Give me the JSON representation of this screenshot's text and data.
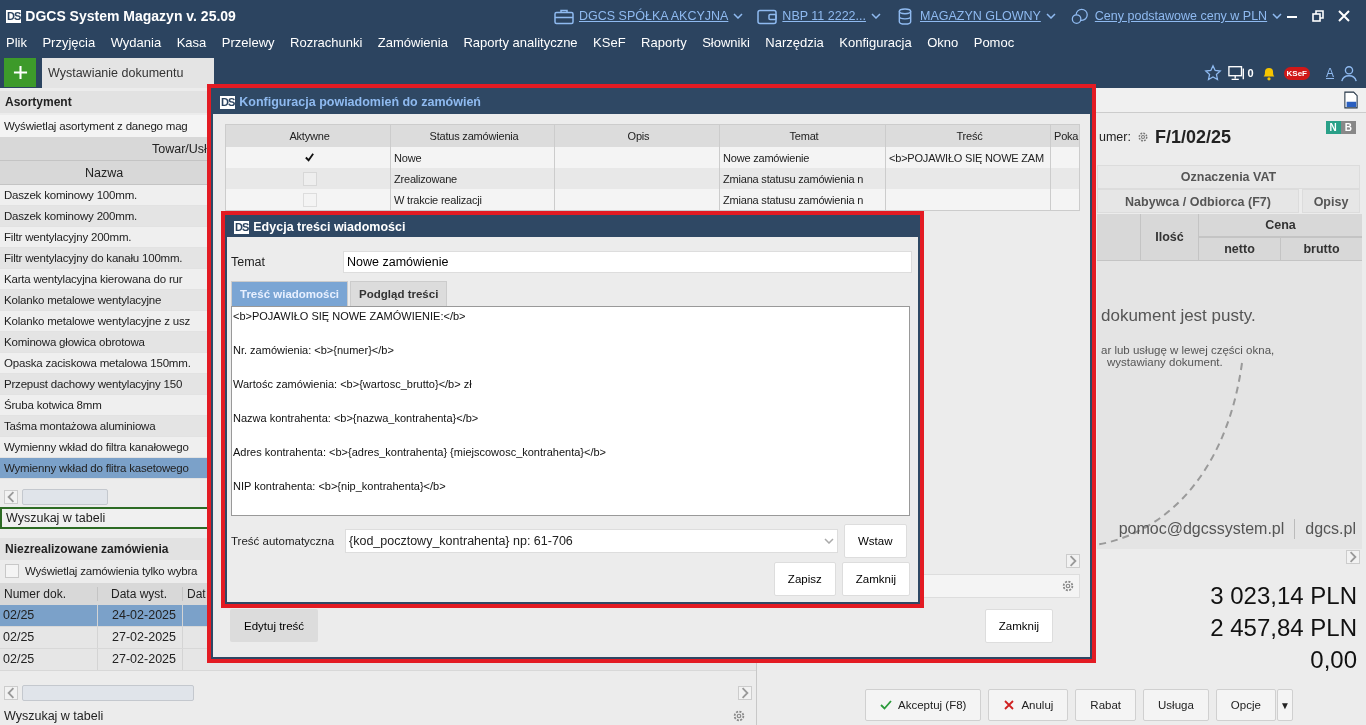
{
  "app": {
    "logo": "DS",
    "title": "DGCS System Magazyn v. 25.09"
  },
  "context": [
    {
      "kind": "company",
      "label": "DGCS SPÓŁKA AKCYJNA"
    },
    {
      "kind": "account",
      "label": "NBP 11 2222..."
    },
    {
      "kind": "warehouse",
      "label": "MAGAZYN GLOWNY"
    },
    {
      "kind": "prices",
      "label": "Ceny podstawowe ceny w PLN"
    }
  ],
  "menu": [
    "Plik",
    "Przyjęcia",
    "Wydania",
    "Kasa",
    "Przelewy",
    "Rozrachunki",
    "Zamówienia",
    "Raporty analityczne",
    "KSeF",
    "Raporty",
    "Słowniki",
    "Narzędzia",
    "Konfiguracja",
    "Okno",
    "Pomoc"
  ],
  "tabs": [
    {
      "label": "Wystawianie dokumentu",
      "selected": true
    }
  ],
  "toolbar": {
    "notifications": "0",
    "ksef": "KSeF",
    "font": "A"
  },
  "assortment": {
    "title": "Asortyment",
    "filter": "Wyświetlaj asortyment z danego mag",
    "group_header": "Towar/Usł",
    "column": "Nazwa",
    "search_placeholder": "Wyszukaj w tabeli",
    "rows": [
      {
        "name": "Daszek kominowy 100mm.",
        "selected": false
      },
      {
        "name": "Daszek kominowy 200mm.",
        "selected": false
      },
      {
        "name": "Filtr wentylacyjny 200mm.",
        "selected": false
      },
      {
        "name": "Filtr wentylacyjny do kanału 100mm.",
        "selected": false
      },
      {
        "name": "Karta wentylacyjna kierowana do rur",
        "selected": false
      },
      {
        "name": "Kolanko metalowe wentylacyjne",
        "selected": false
      },
      {
        "name": "Kolanko metalowe wentylacyjne z usz",
        "selected": false
      },
      {
        "name": "Kominowa głowica obrotowa",
        "selected": false
      },
      {
        "name": "Opaska zaciskowa metalowa 150mm.",
        "selected": false
      },
      {
        "name": "Przepust dachowy wentylacyjny 150",
        "selected": false
      },
      {
        "name": "Śruba kotwica 8mm",
        "selected": false
      },
      {
        "name": "Taśma montażowa aluminiowa",
        "selected": false
      },
      {
        "name": "Wymienny wkład do filtra kanałowego",
        "selected": false
      },
      {
        "name": "Wymienny wkład do flitra kasetowego",
        "selected": true
      }
    ]
  },
  "orders": {
    "title": "Niezrealizowane zamówienia",
    "filter": {
      "label": "Wyświetlaj zamówienia tylko wybra",
      "checked": false
    },
    "columns": [
      "Numer dok.",
      "Data wyst.",
      "Dat"
    ],
    "search_placeholder": "Wyszukaj w tabeli",
    "rows": [
      {
        "number": "02/25",
        "date": "24-02-2025",
        "selected": true
      },
      {
        "number": "02/25",
        "date": "27-02-2025",
        "selected": false
      },
      {
        "number": "02/25",
        "date": "27-02-2025",
        "selected": false
      }
    ]
  },
  "document": {
    "number_label": "umer:",
    "number": "F/1/02/25",
    "badges": [
      "N",
      "B"
    ],
    "vat_header": "Oznaczenia VAT",
    "tabs": [
      {
        "label": "Nabywca / Odbiorca (F7)",
        "selected": false
      },
      {
        "label": "Opisy",
        "selected": false
      }
    ],
    "qty": "Ilość",
    "price": "Cena",
    "net": "netto",
    "gross": "brutto",
    "empty_title": "dokument jest pusty.",
    "empty_hint": [
      "ar lub usługę w lewej części okna,",
      "wystawiany dokument."
    ],
    "contacts": [
      "pomoc@dgcssystem.pl",
      "dgcs.pl"
    ],
    "totals": [
      "3 023,14 PLN",
      "2 457,84 PLN",
      "0,00"
    ],
    "buttons": [
      {
        "kind": "accept",
        "label": "Akceptuj (F8)"
      },
      {
        "kind": "cancel",
        "label": "Anuluj"
      },
      {
        "kind": "plain",
        "label": "Rabat"
      },
      {
        "kind": "plain",
        "label": "Usługa"
      },
      {
        "kind": "plain",
        "label": "Opcje"
      },
      {
        "kind": "menu",
        "label": "▼"
      }
    ]
  },
  "config_dialog": {
    "logo": "DS",
    "title": "Konfiguracja powiadomień do zamówień",
    "columns": [
      "Aktywne",
      "Status zamówienia",
      "Opis",
      "Temat",
      "Treść",
      "Poka"
    ],
    "rows": [
      {
        "active": true,
        "status": "Nowe",
        "subject": "Nowe zamówienie",
        "body": "<b>POJAWIŁO SIĘ NOWE ZAM"
      },
      {
        "active": false,
        "status": "Zrealizowane",
        "subject": "Zmiana statusu zamówienia n"
      },
      {
        "active": false,
        "status": "W trakcie realizacji",
        "subject": "Zmiana statusu zamówienia n"
      }
    ],
    "edit_button": "Edytuj treść",
    "close_button": "Zamknij"
  },
  "editor_dialog": {
    "logo": "DS",
    "title": "Edycja treści wiadomości",
    "subject_label": "Temat",
    "subject": "Nowe zamówienie",
    "tabs": [
      {
        "label": "Treść wiadomości",
        "selected": true
      },
      {
        "label": "Podgląd treści",
        "selected": false
      }
    ],
    "body_lines": [
      "<b>POJAWIŁO SIĘ NOWE ZAMÓWIENIE:</b>",
      "Nr. zamówienia: <b>{numer}</b>",
      "Wartośc zamówienia: <b>{wartosc_brutto}</b> zł",
      "Nazwa kontrahenta: <b>{nazwa_kontrahenta}</b>",
      "Adres kontrahenta: <b>{adres_kontrahenta} {miejscowosc_kontrahenta}</b>",
      "NIP kontrahenta: <b>{nip_kontrahenta}</b>"
    ],
    "auto_label": "Treść automatyczna",
    "auto_value": "{kod_pocztowy_kontrahenta} np: 61-706",
    "insert_button": "Wstaw",
    "save_button": "Zapisz",
    "close_button": "Zamknij"
  }
}
